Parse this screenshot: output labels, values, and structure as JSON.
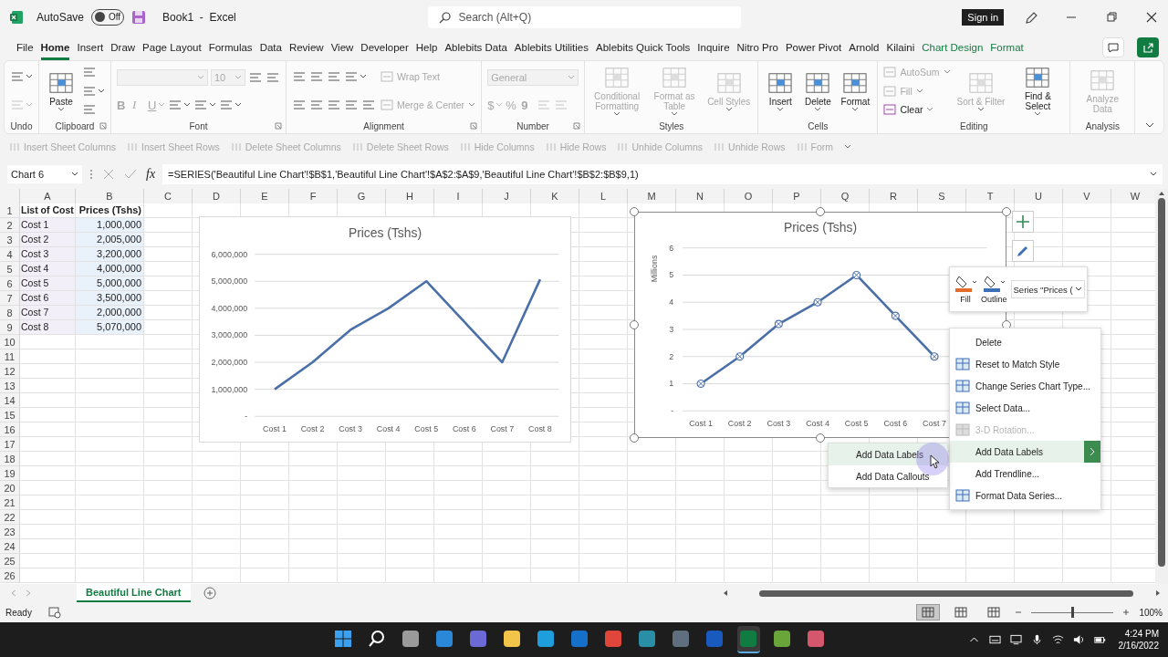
{
  "titlebar": {
    "autosave": {
      "label": "AutoSave",
      "on": false,
      "state_text": "Off"
    },
    "title": "Book1  -  Excel",
    "search": {
      "placeholder": "Search (Alt+Q)"
    },
    "sign_in": "Sign in"
  },
  "tabs": [
    {
      "label": "File",
      "selected": false,
      "contextual": false
    },
    {
      "label": "Home",
      "selected": true,
      "contextual": false
    },
    {
      "label": "Insert",
      "selected": false,
      "contextual": false
    },
    {
      "label": "Draw",
      "selected": false,
      "contextual": false
    },
    {
      "label": "Page Layout",
      "selected": false,
      "contextual": false
    },
    {
      "label": "Formulas",
      "selected": false,
      "contextual": false
    },
    {
      "label": "Data",
      "selected": false,
      "contextual": false
    },
    {
      "label": "Review",
      "selected": false,
      "contextual": false
    },
    {
      "label": "View",
      "selected": false,
      "contextual": false
    },
    {
      "label": "Developer",
      "selected": false,
      "contextual": false
    },
    {
      "label": "Help",
      "selected": false,
      "contextual": false
    },
    {
      "label": "Ablebits Data",
      "selected": false,
      "contextual": false
    },
    {
      "label": "Ablebits Utilities",
      "selected": false,
      "contextual": false
    },
    {
      "label": "Ablebits Quick Tools",
      "selected": false,
      "contextual": false
    },
    {
      "label": "Inquire",
      "selected": false,
      "contextual": false
    },
    {
      "label": "Nitro Pro",
      "selected": false,
      "contextual": false
    },
    {
      "label": "Power Pivot",
      "selected": false,
      "contextual": false
    },
    {
      "label": "Arnold",
      "selected": false,
      "contextual": false
    },
    {
      "label": "Kilaini",
      "selected": false,
      "contextual": false
    },
    {
      "label": "Chart Design",
      "selected": false,
      "contextual": true
    },
    {
      "label": "Format",
      "selected": false,
      "contextual": true
    }
  ],
  "ribbon": {
    "groups": [
      {
        "label": "Undo",
        "launcher": false,
        "columns": [
          [
            [
              {
                "kind": "icon",
                "disabled": false,
                "dropdown": true
              }
            ],
            [
              {
                "kind": "icon",
                "disabled": true,
                "dropdown": true
              }
            ]
          ]
        ]
      },
      {
        "label": "Clipboard",
        "launcher": true,
        "columns": [
          [
            [
              {
                "kind": "large",
                "label": "Paste",
                "disabled": false,
                "dropdown": true
              }
            ]
          ],
          [
            [
              {
                "kind": "icon",
                "disabled": false,
                "dropdown": false
              }
            ],
            [
              {
                "kind": "icon",
                "disabled": false,
                "dropdown": true
              }
            ],
            [
              {
                "kind": "icon",
                "disabled": false,
                "dropdown": false
              }
            ]
          ]
        ]
      },
      {
        "label": "Font",
        "launcher": true,
        "columns": [
          [
            [
              {
                "kind": "box",
                "disabled": true,
                "dropdown": true
              },
              {
                "kind": "box",
                "value": "10",
                "disabled": true,
                "dropdown": true
              },
              {
                "kind": "icon",
                "disabled": false,
                "dropdown": false
              },
              {
                "kind": "icon",
                "disabled": false,
                "dropdown": false
              }
            ],
            [
              {
                "kind": "bold",
                "label": "B",
                "disabled": true,
                "dropdown": false
              },
              {
                "kind": "italic",
                "label": "I",
                "disabled": true,
                "dropdown": false
              },
              {
                "kind": "underline",
                "label": "U",
                "disabled": true,
                "dropdown": true
              },
              {
                "kind": "icon",
                "disabled": false,
                "dropdown": true
              },
              {
                "kind": "icon",
                "disabled": false,
                "dropdown": true
              },
              {
                "kind": "icon",
                "disabled": false,
                "dropdown": true
              }
            ]
          ]
        ]
      },
      {
        "label": "Alignment",
        "launcher": true,
        "columns": [
          [
            [
              {
                "kind": "icon",
                "disabled": false,
                "dropdown": false
              },
              {
                "kind": "icon",
                "disabled": false,
                "dropdown": false
              },
              {
                "kind": "icon",
                "disabled": false,
                "dropdown": false
              },
              {
                "kind": "icon",
                "disabled": false,
                "dropdown": true
              }
            ],
            [
              {
                "kind": "icon",
                "disabled": false,
                "dropdown": false
              },
              {
                "kind": "icon",
                "disabled": false,
                "dropdown": false
              },
              {
                "kind": "icon",
                "disabled": false,
                "dropdown": false
              },
              {
                "kind": "icon",
                "disabled": false,
                "dropdown": false
              },
              {
                "kind": "icon",
                "disabled": false,
                "dropdown": false
              }
            ]
          ],
          [
            [
              {
                "kind": "small",
                "label": "Wrap Text",
                "disabled": true,
                "dropdown": false
              }
            ],
            [
              {
                "kind": "small",
                "label": "Merge & Center",
                "disabled": true,
                "dropdown": true
              }
            ]
          ]
        ]
      },
      {
        "label": "Number",
        "launcher": true,
        "columns": [
          [
            [
              {
                "kind": "box",
                "value": "General",
                "disabled": true,
                "dropdown": true
              }
            ],
            [
              {
                "kind": "currency",
                "label": "$",
                "disabled": true,
                "dropdown": true
              },
              {
                "kind": "percent",
                "label": "%",
                "disabled": true,
                "dropdown": false
              },
              {
                "kind": "comma",
                "label": "9",
                "disabled": true,
                "dropdown": false
              },
              {
                "kind": "icon",
                "disabled": true,
                "dropdown": false
              },
              {
                "kind": "icon",
                "disabled": true,
                "dropdown": false
              }
            ]
          ]
        ]
      },
      {
        "label": "Styles",
        "launcher": false,
        "columns": [
          [
            [
              {
                "kind": "large",
                "label": "Conditional Formatting",
                "disabled": true,
                "dropdown": true
              }
            ]
          ],
          [
            [
              {
                "kind": "large",
                "label": "Format as Table",
                "disabled": true,
                "dropdown": true
              }
            ]
          ],
          [
            [
              {
                "kind": "large",
                "label": "Cell Styles",
                "disabled": true,
                "dropdown": true
              }
            ]
          ]
        ]
      },
      {
        "label": "Cells",
        "launcher": false,
        "columns": [
          [
            [
              {
                "kind": "large",
                "label": "Insert",
                "disabled": false,
                "dropdown": true
              }
            ]
          ],
          [
            [
              {
                "kind": "large",
                "label": "Delete",
                "disabled": false,
                "dropdown": true
              }
            ]
          ],
          [
            [
              {
                "kind": "large",
                "label": "Format",
                "disabled": false,
                "dropdown": true
              }
            ]
          ]
        ]
      },
      {
        "label": "Editing",
        "launcher": false,
        "columns": [
          [
            [
              {
                "kind": "small",
                "label": "AutoSum",
                "disabled": true,
                "dropdown": true
              }
            ],
            [
              {
                "kind": "small",
                "label": "Fill",
                "disabled": true,
                "dropdown": true
              }
            ],
            [
              {
                "kind": "small",
                "label": "Clear",
                "disabled": false,
                "dropdown": true
              }
            ]
          ],
          [
            [
              {
                "kind": "large",
                "label": "Sort & Filter",
                "disabled": true,
                "dropdown": true
              }
            ]
          ],
          [
            [
              {
                "kind": "large",
                "label": "Find & Select",
                "disabled": false,
                "dropdown": true
              }
            ]
          ]
        ]
      },
      {
        "label": "Analysis",
        "launcher": false,
        "columns": [
          [
            [
              {
                "kind": "large",
                "label": "Analyze Data",
                "disabled": true,
                "dropdown": false
              }
            ]
          ]
        ]
      }
    ]
  },
  "quick_toolbar": [
    {
      "label": "Insert Sheet Columns",
      "disabled": true
    },
    {
      "label": "Insert Sheet Rows",
      "disabled": true
    },
    {
      "label": "Delete Sheet Columns",
      "disabled": true
    },
    {
      "label": "Delete Sheet Rows",
      "disabled": true
    },
    {
      "label": "Hide Columns",
      "disabled": true
    },
    {
      "label": "Hide Rows",
      "disabled": true
    },
    {
      "label": "Unhide Columns",
      "disabled": true
    },
    {
      "label": "Unhide Rows",
      "disabled": true
    },
    {
      "label": "Form",
      "disabled": true
    }
  ],
  "formula_bar": {
    "name_box": "Chart 6",
    "fx": "fx",
    "formula": "=SERIES('Beautiful Line Chart'!$B$1,'Beautiful Line Chart'!$A$2:$A$9,'Beautiful Line Chart'!$B$2:$B$9,1)"
  },
  "sheet": {
    "columns": [
      {
        "label": "A"
      },
      {
        "label": "B"
      },
      {
        "label": "C"
      },
      {
        "label": "D"
      },
      {
        "label": "E"
      },
      {
        "label": "F"
      },
      {
        "label": "G"
      },
      {
        "label": "H"
      },
      {
        "label": "I"
      },
      {
        "label": "J"
      },
      {
        "label": "K"
      },
      {
        "label": "L"
      },
      {
        "label": "M"
      },
      {
        "label": "N"
      },
      {
        "label": "O"
      },
      {
        "label": "P"
      },
      {
        "label": "Q"
      },
      {
        "label": "R"
      },
      {
        "label": "S"
      },
      {
        "label": "T"
      },
      {
        "label": "U"
      },
      {
        "label": "V"
      },
      {
        "label": "W"
      }
    ],
    "rows": [
      {
        "number": "1",
        "kind": "header",
        "cells": [
          "List of Cost",
          "Prices (Tshs)"
        ]
      },
      {
        "number": "2",
        "kind": "data",
        "cells": [
          "Cost 1",
          "1,000,000"
        ]
      },
      {
        "number": "3",
        "kind": "data",
        "cells": [
          "Cost 2",
          "2,005,000"
        ]
      },
      {
        "number": "4",
        "kind": "data",
        "cells": [
          "Cost 3",
          "3,200,000"
        ]
      },
      {
        "number": "5",
        "kind": "data",
        "cells": [
          "Cost 4",
          "4,000,000"
        ]
      },
      {
        "number": "6",
        "kind": "data",
        "cells": [
          "Cost 5",
          "5,000,000"
        ]
      },
      {
        "number": "7",
        "kind": "data",
        "cells": [
          "Cost 6",
          "3,500,000"
        ]
      },
      {
        "number": "8",
        "kind": "data",
        "cells": [
          "Cost 7",
          "2,000,000"
        ]
      },
      {
        "number": "9",
        "kind": "data",
        "cells": [
          "Cost 8",
          "5,070,000"
        ]
      },
      {
        "number": "10"
      },
      {
        "number": "11"
      },
      {
        "number": "12"
      },
      {
        "number": "13"
      },
      {
        "number": "14"
      },
      {
        "number": "15"
      },
      {
        "number": "16"
      },
      {
        "number": "17"
      },
      {
        "number": "18"
      },
      {
        "number": "19"
      },
      {
        "number": "20"
      },
      {
        "number": "21"
      },
      {
        "number": "22"
      },
      {
        "number": "23"
      },
      {
        "number": "24"
      },
      {
        "number": "25"
      },
      {
        "number": "26"
      }
    ],
    "charts": [
      {
        "selected": false,
        "chart_data": {
          "type": "line",
          "title": "Prices (Tshs)",
          "grid": true,
          "categories": [
            "Cost 1",
            "Cost 2",
            "Cost 3",
            "Cost 4",
            "Cost 5",
            "Cost 6",
            "Cost 7",
            "Cost 8"
          ],
          "series": [
            {
              "color": "#4a6fa8",
              "marker": false,
              "values": [
                1000000,
                2000000,
                3200000,
                4000000,
                5000000,
                3500000,
                2000000,
                5070000
              ]
            }
          ],
          "ylim": [
            0,
            6000000
          ],
          "yticks": [
            {
              "value": 0,
              "label": "-"
            },
            {
              "value": 1000000,
              "label": "1,000,000"
            },
            {
              "value": 2000000,
              "label": "2,000,000"
            },
            {
              "value": 3000000,
              "label": "3,000,000"
            },
            {
              "value": 4000000,
              "label": "4,000,000"
            },
            {
              "value": 5000000,
              "label": "5,000,000"
            },
            {
              "value": 6000000,
              "label": "6,000,000"
            }
          ]
        }
      },
      {
        "selected": true,
        "chart_data": {
          "type": "line",
          "title": "Prices (Tshs)",
          "grid": true,
          "ylabel": "Millions",
          "categories": [
            "Cost 1",
            "Cost 2",
            "Cost 3",
            "Cost 4",
            "Cost 5",
            "Cost 6",
            "Cost 7"
          ],
          "series": [
            {
              "color": "#4a6fa8",
              "marker": true,
              "values": [
                1,
                2,
                3.2,
                4,
                5,
                3.5,
                2
              ]
            }
          ],
          "ylim": [
            0,
            6
          ],
          "yticks": [
            {
              "value": 0,
              "label": "-"
            },
            1,
            2,
            3,
            4,
            5,
            6
          ]
        }
      }
    ]
  },
  "format_toolbar": {
    "buttons": [
      {
        "label": "Fill"
      },
      {
        "label": "Outline"
      }
    ],
    "series_select": "Series \"Prices ("
  },
  "context_menu": [
    {
      "label": "Delete",
      "kind": "text",
      "disabled": false,
      "selected": false,
      "submenu": false
    },
    {
      "label": "Reset to Match Style",
      "kind": "icon",
      "disabled": false,
      "selected": false,
      "submenu": false
    },
    {
      "label": "Change Series Chart Type...",
      "kind": "icon",
      "disabled": false,
      "selected": false,
      "submenu": false
    },
    {
      "label": "Select Data...",
      "kind": "icon",
      "disabled": false,
      "selected": false,
      "submenu": false
    },
    {
      "label": "3-D Rotation...",
      "kind": "icon",
      "disabled": true,
      "selected": false,
      "submenu": false
    },
    {
      "label": "Add Data Labels",
      "kind": "text",
      "disabled": false,
      "selected": true,
      "submenu": true
    },
    {
      "label": "Add Trendline...",
      "kind": "text",
      "disabled": false,
      "selected": false,
      "submenu": false
    },
    {
      "label": "Format Data Series...",
      "kind": "icon",
      "disabled": false,
      "selected": false,
      "submenu": false
    }
  ],
  "submenu": [
    {
      "label": "Add Data Labels",
      "selected": true
    },
    {
      "label": "Add Data Callouts",
      "selected": false
    }
  ],
  "sheet_tabs": [
    {
      "label": "Beautiful Line Chart",
      "selected": true
    }
  ],
  "status_bar": {
    "status": "Ready",
    "views": [
      {
        "selected": true
      },
      {
        "selected": false
      },
      {
        "selected": false
      }
    ],
    "zoom": {
      "level": 0.5,
      "reading": "100%"
    }
  },
  "taskbar": {
    "apps": [
      {
        "kind": "start",
        "selected": false
      },
      {
        "kind": "search",
        "selected": false
      },
      {
        "kind": "app",
        "color": "#9a9a9a",
        "selected": false
      },
      {
        "kind": "app",
        "color": "#2b88d8",
        "selected": false
      },
      {
        "kind": "app",
        "color": "#6b69d6",
        "selected": false
      },
      {
        "kind": "app",
        "color": "#f2c54a",
        "selected": false
      },
      {
        "kind": "app",
        "color": "#1f9ede",
        "selected": false
      },
      {
        "kind": "app",
        "color": "#1570c9",
        "selected": false
      },
      {
        "kind": "app",
        "color": "#e0463a",
        "selected": false
      },
      {
        "kind": "app",
        "color": "#2a8fa6",
        "selected": false
      },
      {
        "kind": "app",
        "color": "#5f6f7f",
        "selected": false
      },
      {
        "kind": "app",
        "color": "#185abd",
        "selected": false
      },
      {
        "kind": "app",
        "color": "#107c41",
        "selected": true
      },
      {
        "kind": "app",
        "color": "#6aa53a",
        "selected": false
      },
      {
        "kind": "app",
        "color": "#d4576e",
        "selected": false
      }
    ],
    "time": "4:24 PM",
    "date": "2/16/2022"
  }
}
